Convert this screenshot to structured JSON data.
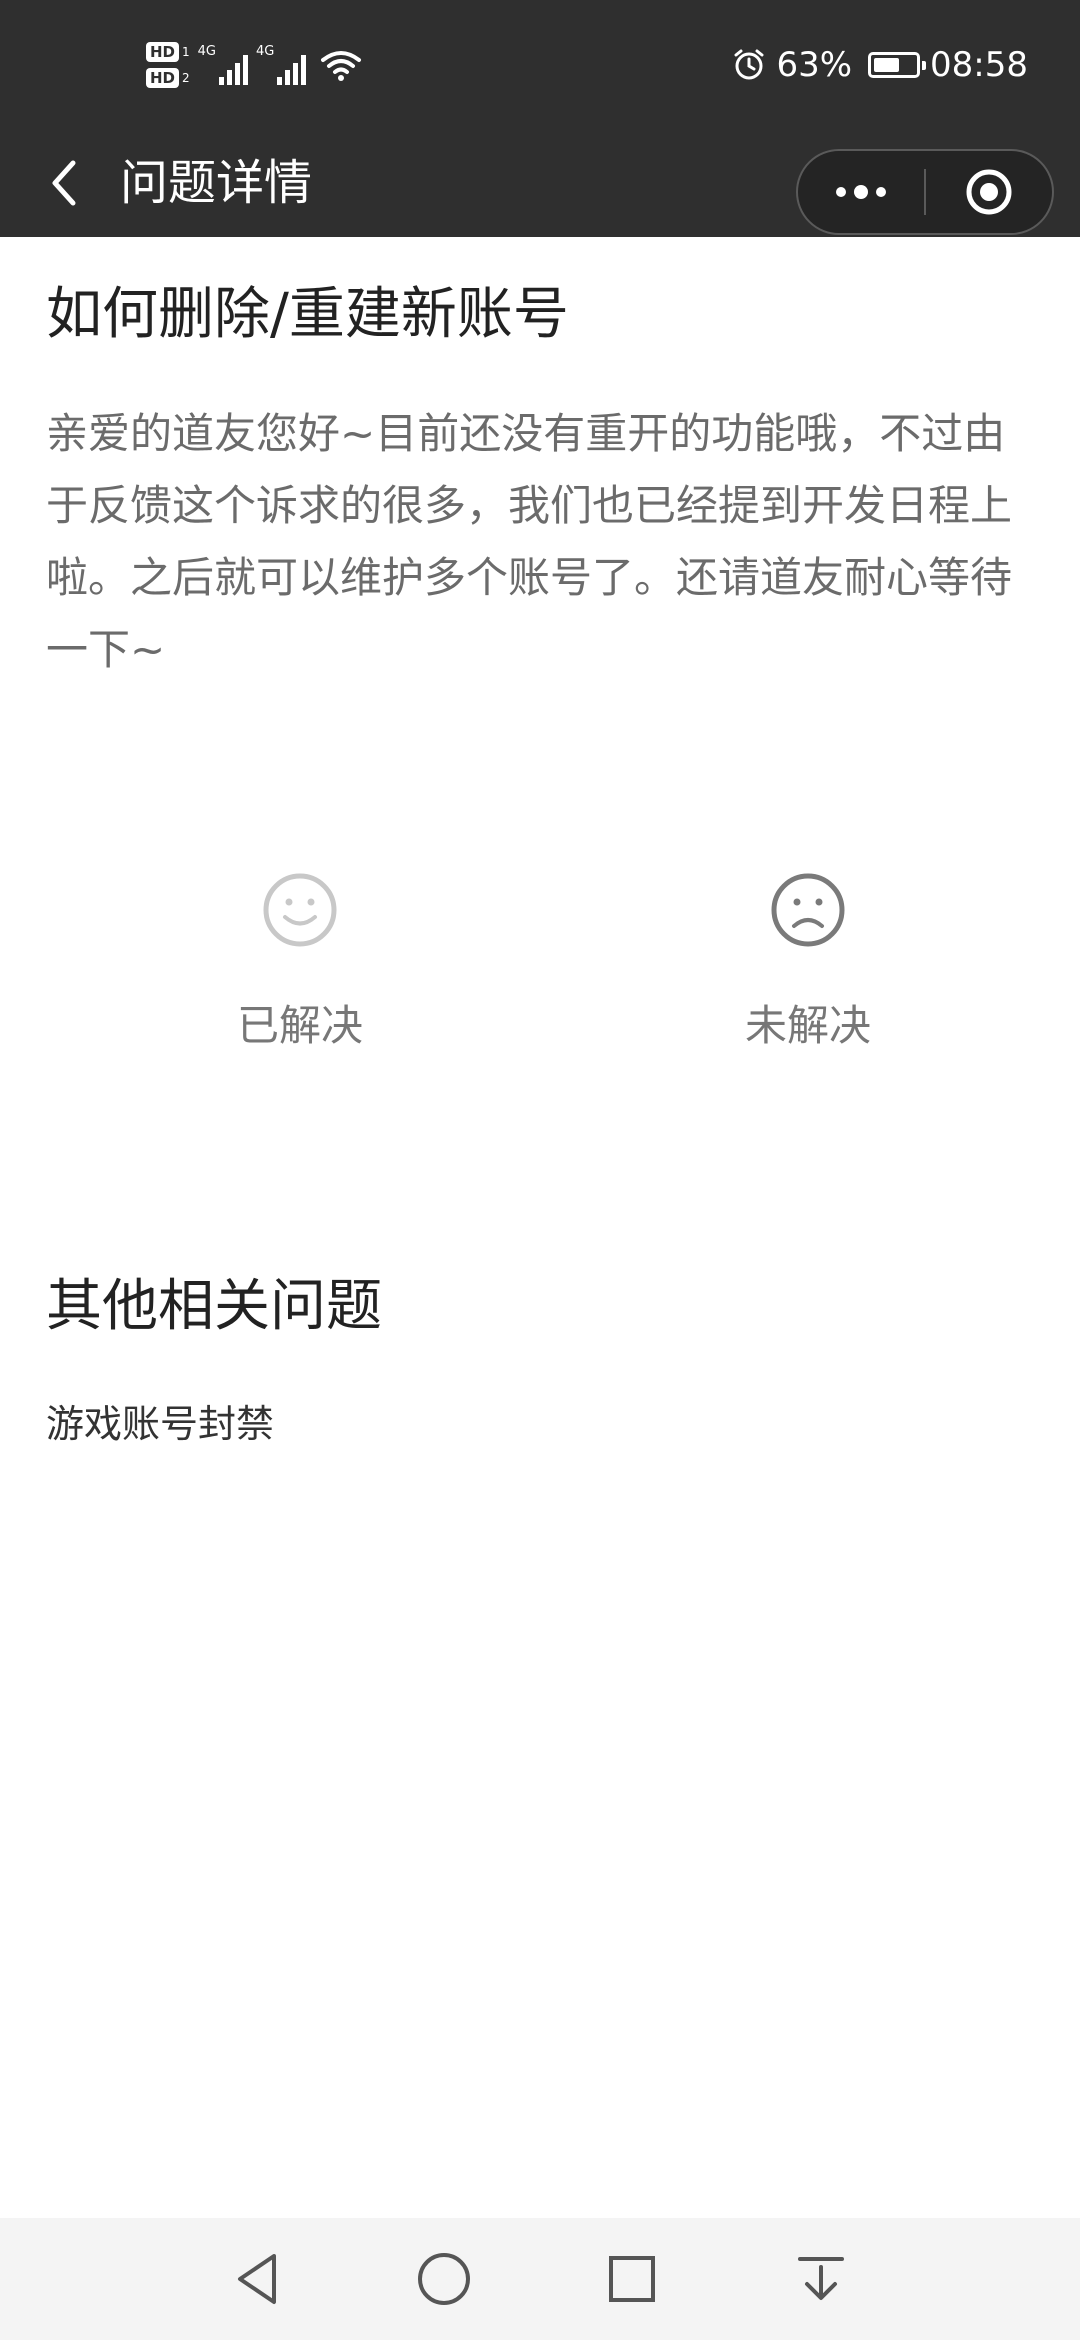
{
  "status_bar": {
    "sim1_label": "HD",
    "sim1_slot": "1",
    "sim2_label": "HD",
    "sim2_slot": "2",
    "network_1": "4G",
    "network_2": "4G",
    "battery_percent": "63%",
    "battery_level": 0.63,
    "time": "08:58",
    "icons": [
      "hd-icon",
      "signal-icon",
      "wifi-icon",
      "alarm-icon",
      "battery-icon"
    ]
  },
  "nav": {
    "title": "问题详情",
    "icons": [
      "back-arrow-icon",
      "more-dots-icon",
      "close-circle-icon"
    ]
  },
  "question": {
    "title": "如何删除/重建新账号",
    "answer": "亲爱的道友您好~目前还没有重开的功能哦，不过由于反馈这个诉求的很多，我们也已经提到开发日程上啦。之后就可以维护多个账号了。还请道友耐心等待一下~"
  },
  "feedback": {
    "solved_label": "已解决",
    "unsolved_label": "未解决",
    "icons": [
      "smiley-face-icon",
      "sad-face-icon"
    ]
  },
  "related": {
    "title": "其他相关问题",
    "items": [
      {
        "label": "游戏账号封禁"
      }
    ]
  },
  "system_nav": {
    "icons": [
      "back-triangle-icon",
      "home-circle-icon",
      "recents-square-icon",
      "notification-pull-icon"
    ]
  }
}
